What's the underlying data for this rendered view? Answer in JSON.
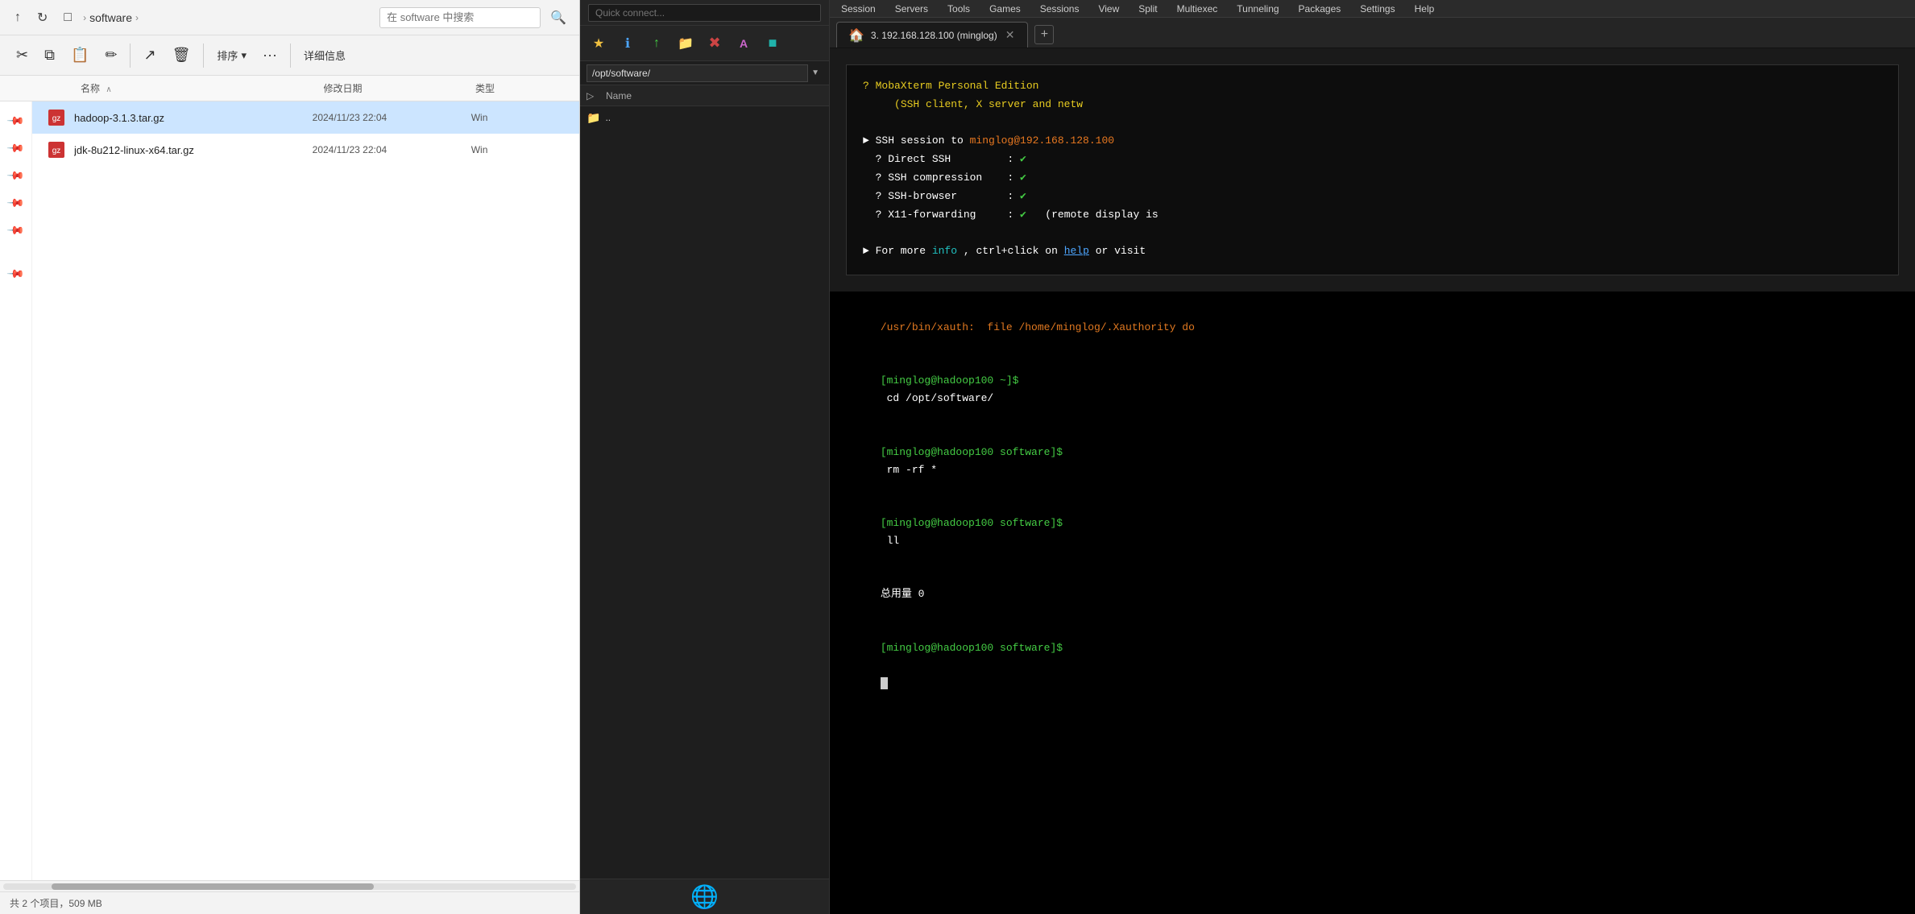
{
  "explorer": {
    "title": "software",
    "breadcrumb": [
      "software"
    ],
    "search_placeholder": "在 software 中搜索",
    "toolbar": {
      "cut": "✂",
      "copy": "⧉",
      "paste": "📋",
      "rename": "✏",
      "share": "↗",
      "delete": "🗑",
      "sort": "排序",
      "more": "···",
      "details": "详细信息"
    },
    "columns": {
      "name": "名称",
      "sort_indicator": "∧",
      "date": "修改日期",
      "type": "类型"
    },
    "files": [
      {
        "name": "hadoop-3.1.3.tar.gz",
        "date": "2024/11/23 22:04",
        "type": "Win",
        "icon": "🗜"
      },
      {
        "name": "jdk-8u212-linux-x64.tar.gz",
        "date": "2024/11/23 22:04",
        "type": "Win",
        "icon": "🗜"
      }
    ],
    "statusbar": {
      "count": "共 2 个项目，509 MB",
      "selected": ""
    },
    "pins": [
      "📌",
      "📌",
      "📌",
      "📌",
      "📌",
      "📌"
    ]
  },
  "sftp": {
    "quickconnect": "Quick connect...",
    "path": "/opt/software/",
    "column_name": "Name",
    "files": [
      {
        "name": "..",
        "icon": "📁"
      }
    ],
    "toolbar_icons": [
      "t",
      "↑",
      "↑↑",
      "📁",
      "✖",
      "A",
      "■"
    ]
  },
  "terminal": {
    "menubar_items": [
      "Session",
      "Servers",
      "Tools",
      "Games",
      "Sessions",
      "View",
      "Split",
      "Multiexec",
      "Tunneling",
      "Packages",
      "Settings",
      "Help"
    ],
    "tab_label": "3. 192.168.128.100 (minglog)",
    "tab_home_icon": "🏠",
    "tab_add_icon": "+",
    "welcome": {
      "line1": "? MobaXterm Personal Edition",
      "line2": "(SSH client, X server and netw",
      "ssh_session_label": "► SSH session to ",
      "ssh_host": "minglog@192.168.128.100",
      "direct_ssh": "? Direct SSH          : ✔",
      "ssh_compression": "? SSH compression     : ✔",
      "ssh_browser": "? SSH-browser         : ✔",
      "x11_forwarding": "? X11-forwarding      : ✔  (remote display is",
      "more_info_line": "► For more info, ctrl+click on help or visit"
    },
    "terminal_lines": [
      "/usr/bin/xauth:  file /home/minglog/.Xauthority do",
      "[minglog@hadoop100 ~]$ cd /opt/software/",
      "[minglog@hadoop100 software]$ rm -rf *",
      "[minglog@hadoop100 software]$ ll",
      "总用量 0",
      "[minglog@hadoop100 software]$ "
    ]
  }
}
